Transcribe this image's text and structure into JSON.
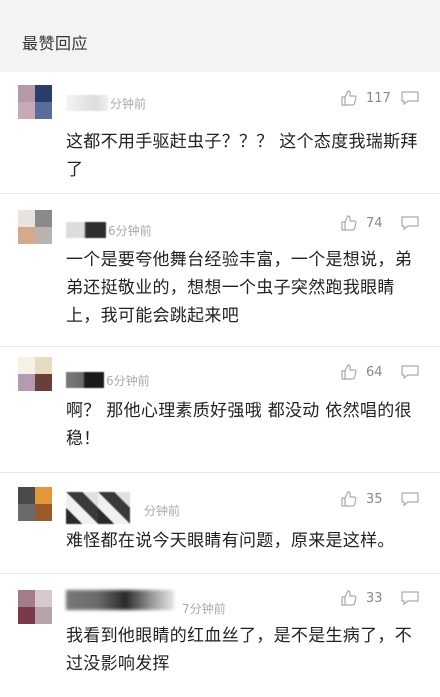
{
  "section": {
    "title": "最赞回应"
  },
  "comments": [
    {
      "time": "分钟前",
      "likes": "117",
      "text": "这都不用手驱赶虫子？？？ 这个态度我瑞斯拜了",
      "avatar_colors": [
        "#b49aa6",
        "#2b3d6a",
        "#c9a9b5",
        "#5b6c9b"
      ]
    },
    {
      "time": "6分钟前",
      "likes": "74",
      "text": "一个是要夸他舞台经验丰富，一个是想说，弟弟还挺敬业的，想想一个虫子突然跑我眼睛上，我可能会跳起来吧",
      "avatar_colors": [
        "#e9e2df",
        "#8a8a8a",
        "#d7a98c",
        "#b9b2ae"
      ]
    },
    {
      "time": "6分钟前",
      "likes": "64",
      "text": "啊？ 那他心理素质好强哦 都没动 依然唱的很稳！",
      "avatar_colors": [
        "#f5f1e4",
        "#e7dcc2",
        "#b49ab2",
        "#6a3f3a"
      ]
    },
    {
      "time": "分钟前",
      "likes": "35",
      "text": "难怪都在说今天眼睛有问题，原来是这样。",
      "avatar_colors": [
        "#4a4a4a",
        "#e2983a",
        "#6b6b6b",
        "#9a5a2a"
      ]
    },
    {
      "time": "7分钟前",
      "likes": "33",
      "text": "我看到他眼睛的红血丝了，是不是生病了，不过没影响发挥",
      "avatar_colors": [
        "#a37c8c",
        "#d7c8cf",
        "#7a3a4a",
        "#b6a3ac"
      ]
    }
  ]
}
